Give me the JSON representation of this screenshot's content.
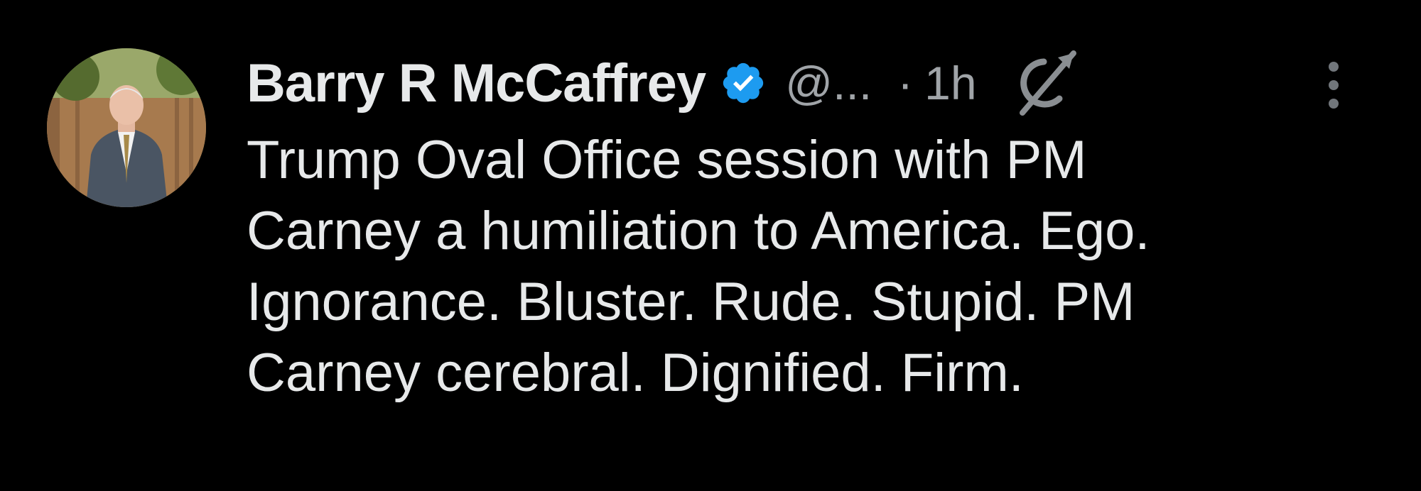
{
  "author": {
    "display_name": "Barry R McCaffrey",
    "handle": "@...",
    "separator": "·",
    "time": "1h",
    "verified_icon": "verified-badge-icon",
    "verified_color": "#1d9bf0"
  },
  "icons": {
    "grok": "grok-icon",
    "more": "more-vertical-icon"
  },
  "tweet": {
    "lines": [
      "Trump Oval Office session with PM",
      "Carney a humiliation to America. Ego.",
      "Ignorance. Bluster. Rude. Stupid. PM",
      "Carney cerebral. Dignified. Firm."
    ]
  },
  "colors": {
    "background": "#000000",
    "primary_text": "#e7e9ea",
    "secondary_text": "#a0a4a8"
  }
}
